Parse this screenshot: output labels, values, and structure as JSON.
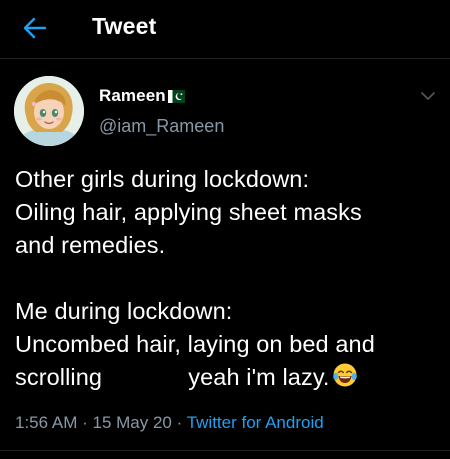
{
  "header": {
    "title": "Tweet",
    "back_icon": "arrow-left-icon"
  },
  "author": {
    "display_name": "Rameen",
    "flag_icon": "pakistan-flag-icon",
    "handle": "@iam_Rameen",
    "avatar_icon": "cartoon-girl-avatar"
  },
  "tweet": {
    "lines_part1": [
      "Other girls during lockdown:",
      "Oiling hair, applying sheet masks",
      "and remedies."
    ],
    "lines_part2": [
      "Me during lockdown:",
      "Uncombed hair, laying on bed and",
      "scrolling             yeah i'm lazy."
    ],
    "trailing_emoji": "face-with-tears-of-joy-icon"
  },
  "meta": {
    "time": "1:56 AM",
    "separator": " · ",
    "date": "15 May 20",
    "source": "Twitter for Android"
  },
  "colors": {
    "background": "#000000",
    "text": "#ffffff",
    "secondary_text": "#8899a6",
    "accent": "#1da1f2"
  }
}
